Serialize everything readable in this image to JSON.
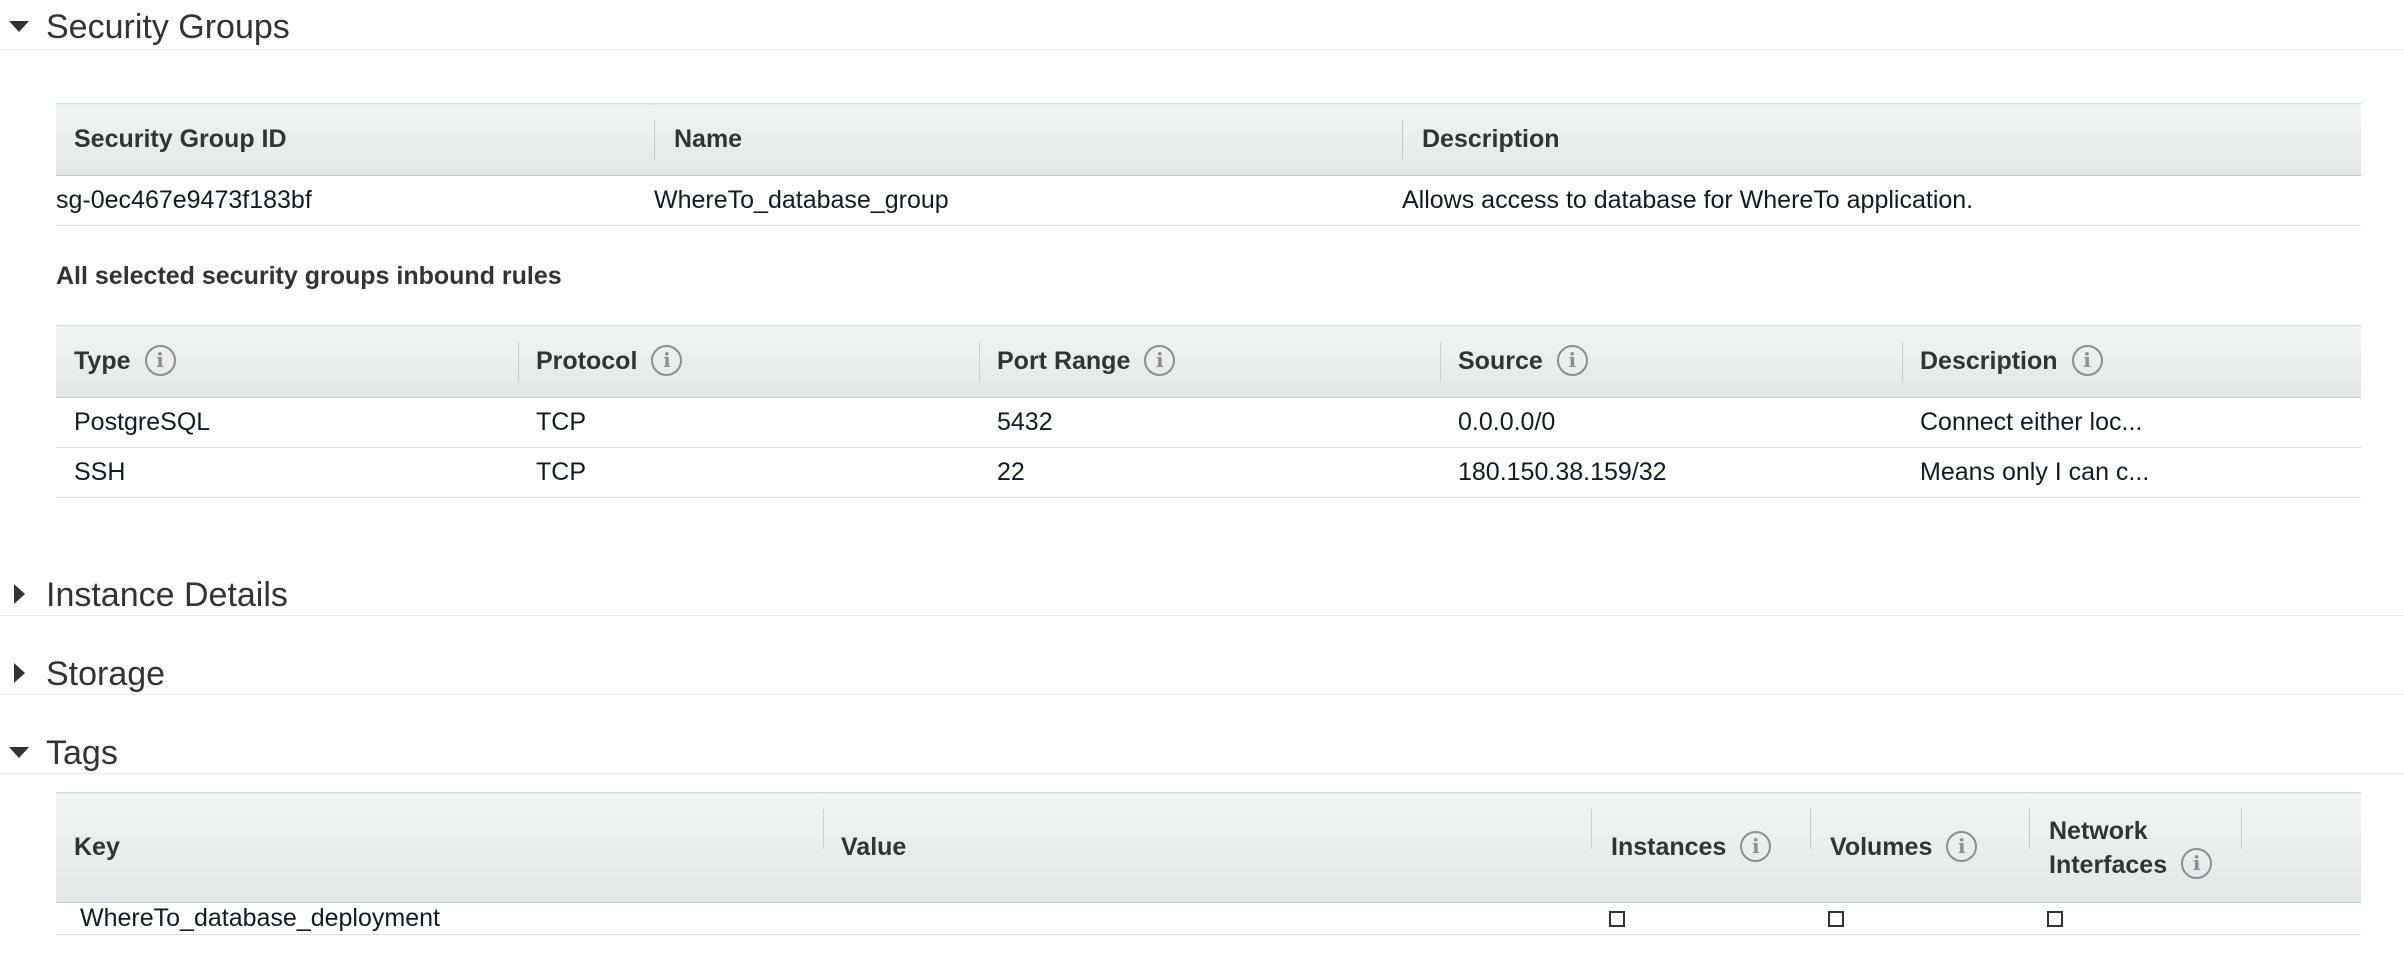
{
  "sections": {
    "security_groups": {
      "title": "Security Groups",
      "expanded": true
    },
    "instance_details": {
      "title": "Instance Details",
      "expanded": false
    },
    "storage": {
      "title": "Storage",
      "expanded": false
    },
    "tags": {
      "title": "Tags",
      "expanded": true
    }
  },
  "security_groups_table": {
    "headers": [
      "Security Group ID",
      "Name",
      "Description"
    ],
    "rows": [
      [
        "sg-0ec467e9473f183bf",
        "WhereTo_database_group",
        "Allows access to database for WhereTo application."
      ]
    ]
  },
  "inbound_rules": {
    "heading": "All selected security groups inbound rules",
    "headers": [
      "Type",
      "Protocol",
      "Port Range",
      "Source",
      "Description"
    ],
    "rows": [
      [
        "PostgreSQL",
        "TCP",
        "5432",
        "0.0.0.0/0",
        "Connect either loc..."
      ],
      [
        "SSH",
        "TCP",
        "22",
        "180.150.38.159/32",
        "Means only I can c..."
      ]
    ]
  },
  "tags_table": {
    "headers": [
      "Key",
      "Value",
      "Instances",
      "Volumes",
      "Network Interfaces"
    ],
    "network_interfaces_line1": "Network",
    "network_interfaces_line2": "Interfaces",
    "rows": [
      {
        "key": "WhereTo_database_deployment",
        "value": "",
        "instances": false,
        "volumes": false,
        "network_interfaces": false
      }
    ]
  },
  "icons": {
    "info": "info-icon",
    "expanded": "caret-down-icon",
    "collapsed": "caret-right-icon",
    "info_glyph": "i"
  },
  "colors": {
    "header_bg": "#e9ebeb",
    "border": "#dadede",
    "text": "#16191f"
  }
}
